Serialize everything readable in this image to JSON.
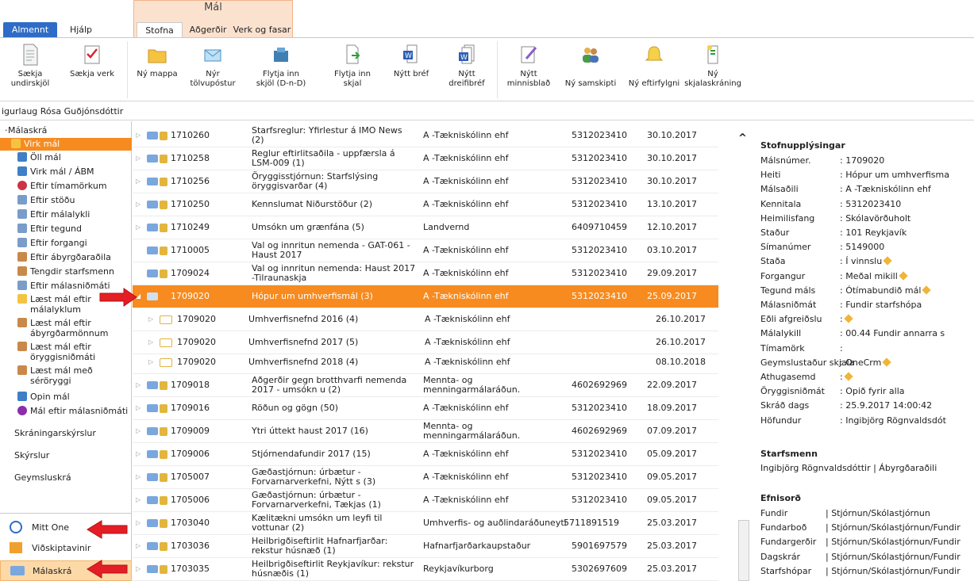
{
  "ribbon": {
    "tabs": [
      "Almennt",
      "Hjálp",
      "Stofna",
      "Aðgerðir",
      "Verk og fasar"
    ],
    "group_title": "Mál",
    "buttons": [
      {
        "label": "Sækja undirskjöl",
        "icon": "document-icon"
      },
      {
        "label": "Sækja verk",
        "icon": "checklist-icon"
      },
      {
        "label": "Ný mappa",
        "icon": "folder-icon"
      },
      {
        "label": "Nýr tölvupóstur",
        "icon": "email-icon"
      },
      {
        "label": "Flytja inn skjöl (D-n-D)",
        "icon": "import-box-icon"
      },
      {
        "label": "Flytja inn skjal",
        "icon": "import-document-icon"
      },
      {
        "label": "Nýtt bréf",
        "icon": "word-document-icon"
      },
      {
        "label": "Nýtt dreifibréf",
        "icon": "word-multi-document-icon"
      },
      {
        "label": "Nýtt minnisblað",
        "icon": "memo-icon"
      },
      {
        "label": "Ný samskipti",
        "icon": "people-icon"
      },
      {
        "label": "Ný eftirfylgni",
        "icon": "bell-icon"
      },
      {
        "label": "Ný skjalaskráning",
        "icon": "register-document-icon"
      }
    ]
  },
  "user": {
    "name": "igurlaug Rósa Guðjónsdóttir"
  },
  "sidebar": {
    "root": "Málaskrá",
    "items": [
      {
        "label": "Virk mál",
        "icon": "folder-icon",
        "selected": true
      },
      {
        "label": "Öll mál",
        "icon": "database-icon"
      },
      {
        "label": "Virk mál / ÁBM",
        "icon": "database-icon"
      },
      {
        "label": "Eftir tímamörkum",
        "icon": "clock-icon"
      },
      {
        "label": "Eftir stöðu",
        "icon": "list-icon"
      },
      {
        "label": "Eftir málalykli",
        "icon": "list-icon"
      },
      {
        "label": "Eftir tegund",
        "icon": "list-icon"
      },
      {
        "label": "Eftir forgangi",
        "icon": "list-icon"
      },
      {
        "label": "Eftir ábyrgðaraðila",
        "icon": "people-icon"
      },
      {
        "label": "Tengdir starfsmenn",
        "icon": "people-icon"
      },
      {
        "label": "Eftir málasniðmáti",
        "icon": "list-icon"
      }
    ],
    "items_two_line": [
      {
        "line1": "Læst mál eftir",
        "line2": "málalyklum",
        "icon": "lock-folder-icon"
      },
      {
        "line1": "Læst mál eftir",
        "line2": "ábyrgðarmönnum",
        "icon": "people-icon"
      },
      {
        "line1": "Læst mál eftir",
        "line2": "öryggisniðmáti",
        "icon": "people-icon"
      },
      {
        "line1": "Læst mál með",
        "line2": "séröryggi",
        "icon": "people-icon"
      }
    ],
    "items_after": [
      {
        "label": "Opin mál",
        "icon": "database-icon"
      },
      {
        "label": "Mál eftir málasniðmáti",
        "icon": "shapes-icon"
      }
    ],
    "sections": [
      "Skráningarskýrslur",
      "Skýrslur",
      "Geymsluskrá"
    ],
    "bottom": [
      {
        "label": "Mitt One",
        "icon": "smiley-icon"
      },
      {
        "label": "Viðskiptavinir",
        "icon": "house-icon"
      },
      {
        "label": "Málaskrá",
        "icon": "folder-icon",
        "selected": true
      }
    ]
  },
  "list": {
    "rows": [
      {
        "num": "1710260",
        "title": "Starfsreglur: Yfirlestur á IMO News (2)",
        "party": "A -Tækniskólinn ehf",
        "kt": "5312023410",
        "date": "30.10.2017"
      },
      {
        "num": "1710258",
        "title": "Reglur eftirlitsaðila - uppfærsla á LSM-009 (1)",
        "party": "A -Tækniskólinn ehf",
        "kt": "5312023410",
        "date": "30.10.2017"
      },
      {
        "num": "1710256",
        "title": "Öryggisstjórnun: Starfslýsing öryggisvarðar (4)",
        "party": "A -Tækniskólinn ehf",
        "kt": "5312023410",
        "date": "30.10.2017"
      },
      {
        "num": "1710250",
        "title": "Kennslumat Niðurstöður (2)",
        "party": "A -Tækniskólinn ehf",
        "kt": "5312023410",
        "date": "13.10.2017"
      },
      {
        "num": "1710249",
        "title": "Umsókn um grænfána (5)",
        "party": "Landvernd",
        "kt": "6409710459",
        "date": "12.10.2017"
      },
      {
        "num": "1710005",
        "title": "Val og innritun nemenda - GAT-061 - Haust 2017",
        "party": "A -Tækniskólinn ehf",
        "kt": "5312023410",
        "date": "03.10.2017"
      },
      {
        "num": "1709024",
        "title": "Val og innritun nemenda: Haust 2017 -Tilraunaskja",
        "party": "A -Tækniskólinn ehf",
        "kt": "5312023410",
        "date": "29.09.2017"
      },
      {
        "num": "1709020",
        "title": "Hópur um umhverfismál (3)",
        "party": "A -Tækniskólinn ehf",
        "kt": "5312023410",
        "date": "25.09.2017",
        "selected": true
      },
      {
        "num": "1709020",
        "title": "Umhverfisnefnd 2016 (4)",
        "party": "A -Tækniskólinn ehf",
        "kt": "",
        "date": "26.10.2017",
        "child": true
      },
      {
        "num": "1709020",
        "title": "Umhverfisnefnd 2017 (5)",
        "party": "A -Tækniskólinn ehf",
        "kt": "",
        "date": "26.10.2017",
        "child": true
      },
      {
        "num": "1709020",
        "title": "Umhverfisnefnd 2018 (4)",
        "party": "A -Tækniskólinn ehf",
        "kt": "",
        "date": "08.10.2018",
        "child": true
      },
      {
        "num": "1709018",
        "title": "Aðgerðir gegn brotthvarfi nemenda 2017 - umsókn u (2)",
        "party": "Mennta- og menningarmálaráðun.",
        "kt": "4602692969",
        "date": "22.09.2017"
      },
      {
        "num": "1709016",
        "title": "Röðun og gögn (50)",
        "party": "A -Tækniskólinn ehf",
        "kt": "5312023410",
        "date": "18.09.2017"
      },
      {
        "num": "1709009",
        "title": "Ytri úttekt haust 2017 (16)",
        "party": "Mennta- og menningarmálaráðun.",
        "kt": "4602692969",
        "date": "07.09.2017"
      },
      {
        "num": "1709006",
        "title": "Stjórnendafundir 2017 (15)",
        "party": "A -Tækniskólinn ehf",
        "kt": "5312023410",
        "date": "05.09.2017"
      },
      {
        "num": "1705007",
        "title": "Gæðastjórnun: úrbætur - Forvarnarverkefni, Nýtt s (3)",
        "party": "A -Tækniskólinn ehf",
        "kt": "5312023410",
        "date": "09.05.2017"
      },
      {
        "num": "1705006",
        "title": "Gæðastjórnun: úrbætur - Forvarnarverkefni, Tækjas (1)",
        "party": "A -Tækniskólinn ehf",
        "kt": "5312023410",
        "date": "09.05.2017"
      },
      {
        "num": "1703040",
        "title": "Kælitækni umsókn um leyfi til vottunar (2)",
        "party": "Umhverfis- og auðlindaráðuneyti",
        "kt": "5711891519",
        "date": "25.03.2017"
      },
      {
        "num": "1703036",
        "title": "Heilbrigðiseftirlit Hafnarfjarðar: rekstur húsnæð (1)",
        "party": "Hafnarfjarðarkaupstaður",
        "kt": "5901697579",
        "date": "25.03.2017"
      },
      {
        "num": "1703035",
        "title": "Heilbrigðiseftirlit Reykjavíkur: rekstur húsnæðis (1)",
        "party": "Reykjavíkurborg",
        "kt": "5302697609",
        "date": "25.03.2017"
      }
    ]
  },
  "details": {
    "collapse_glyph": "^",
    "section1": "Stofnupplýsingar",
    "fields": [
      {
        "label": "Málsnúmer.",
        "value": ": 1709020"
      },
      {
        "label": "Heiti",
        "value": ": Hópur um umhverfisma"
      },
      {
        "label": "Málsaðili",
        "value": ": A -Tækniskólinn ehf"
      },
      {
        "label": "Kennitala",
        "value": ": 5312023410"
      },
      {
        "label": "Heimilisfang",
        "value": ": Skólavörðuholt"
      },
      {
        "label": "Staður",
        "value": ": 101 Reykjavík"
      },
      {
        "label": "Símanúmer",
        "value": ": 5149000"
      },
      {
        "label": "Staða",
        "value": ": Í vinnslu",
        "edit": true
      },
      {
        "label": "Forgangur",
        "value": ": Meðal mikill",
        "edit": true
      },
      {
        "label": "Tegund máls",
        "value": ": Ótímabundið mál",
        "edit": true
      },
      {
        "label": "Málasniðmát",
        "value": ": Fundir starfshópa"
      },
      {
        "label": "Eðli afgreiðslu",
        "value": ":",
        "edit": true
      },
      {
        "label": "Málalykill",
        "value": ": 00.44 Fundir annarra s"
      },
      {
        "label": "Tímamörk",
        "value": ":"
      },
      {
        "label": "Geymslustaður skjala",
        "value": ": OneCrm",
        "edit": true
      },
      {
        "label": "Athugasemd",
        "value": ":",
        "edit": true
      },
      {
        "label": "Öryggisniðmát",
        "value": ": Opið fyrir alla"
      },
      {
        "label": "Skráð dags",
        "value": ": 25.9.2017 14:00:42"
      },
      {
        "label": "Höfundur",
        "value": ": Ingibjörg Rögnvaldsdót"
      }
    ],
    "section2": "Starfsmenn",
    "staff": "Ingibjörg Rögnvaldsdóttir | Ábyrgðaraðili",
    "section3": "Efnisorð",
    "keywords": [
      {
        "label": "Fundir",
        "value": "| Stjórnun/Skólastjórnun"
      },
      {
        "label": "Fundarboð",
        "value": "| Stjórnun/Skólastjórnun/Fundir"
      },
      {
        "label": "Fundargerðir",
        "value": "| Stjórnun/Skólastjórnun/Fundir"
      },
      {
        "label": "Dagskrár",
        "value": "| Stjórnun/Skólastjórnun/Fundir"
      },
      {
        "label": "Starfshópar",
        "value": "| Stjórnun/Skólastjórnun/Fundir"
      }
    ]
  },
  "colors": {
    "accent": "#f78b1f",
    "tab_blue": "#2e6cc7",
    "arrow_red": "#e31e24"
  }
}
